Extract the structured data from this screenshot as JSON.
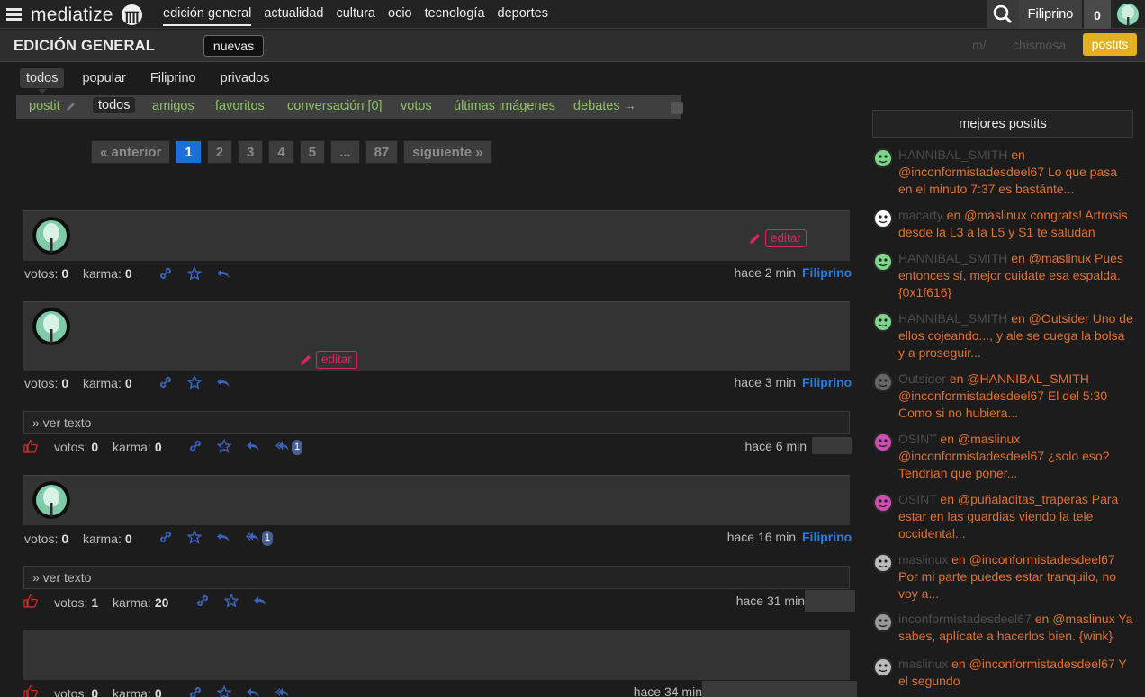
{
  "topbar": {
    "brand": "mediatize",
    "nav": [
      "edición general",
      "actualidad",
      "cultura",
      "ocio",
      "tecnología",
      "deportes"
    ],
    "user": "Filiprino",
    "notifications": "0"
  },
  "subbar": {
    "title": "EDICIÓN GENERAL",
    "nuevas": "nuevas",
    "m": "m/",
    "chismosa": "chismosa",
    "postits": "postits"
  },
  "tabs1": [
    "todos",
    "popular",
    "Filiprino",
    "privados"
  ],
  "tabs2": {
    "postit": "postit",
    "items": [
      "todos",
      "amigos",
      "favoritos",
      "conversación [0]",
      "votos",
      "últimas imágenes",
      "debates →"
    ]
  },
  "pager": [
    "« anterior",
    "1",
    "2",
    "3",
    "4",
    "5",
    "...",
    "87",
    "siguiente »"
  ],
  "labels": {
    "votos": "votos:",
    "karma": "karma:",
    "edit": "editar",
    "ver_texto": "» ver texto"
  },
  "posts": [
    {
      "votos": "0",
      "karma": "0",
      "time": "hace 2 min",
      "author": "Filiprino"
    },
    {
      "votos": "0",
      "karma": "0",
      "time": "hace 3 min",
      "author": "Filiprino"
    },
    {
      "votos": "0",
      "karma": "0",
      "time": "hace 6 min",
      "replies": "1"
    },
    {
      "votos": "0",
      "karma": "0",
      "time": "hace 16 min",
      "author": "Filiprino",
      "replies": "1"
    },
    {
      "votos": "1",
      "karma": "20",
      "time": "hace 31 min"
    },
    {
      "votos": "0",
      "karma": "0",
      "time": "hace 34 min"
    }
  ],
  "sidebar": {
    "title": "mejores postits",
    "en": "en",
    "items": [
      {
        "user": "HANNIBAL_SMITH",
        "text": "@inconformistadesdeel67 Lo que pasa en el minuto 7:37 es bastánte..."
      },
      {
        "user": "macarty",
        "text": "@maslinux congrats! Artrosis desde la L3 a la L5 y S1 te saludan"
      },
      {
        "user": "HANNIBAL_SMITH",
        "text": "@maslinux Pues entonces sí, mejor cuidate esa espalda. {0x1f616}"
      },
      {
        "user": "HANNIBAL_SMITH",
        "text": "@Outsider Uno de ellos cojeando..., y ale se cuega la bolsa y a proseguir..."
      },
      {
        "user": "Outsider",
        "text": "@HANNIBAL_SMITH @inconformistadesdeel67 El del 5:30 Como si no hubiera..."
      },
      {
        "user": "OSINT",
        "text": "@maslinux @inconformistadesdeel67 ¿solo eso? Tendrían que poner..."
      },
      {
        "user": "OSINT",
        "text": "@puñaladitas_traperas Para estar en las guardias viendo la tele occidental..."
      },
      {
        "user": "maslinux",
        "text": "@inconformistadesdeel67 Por mi parte puedes estar tranquilo, no voy a..."
      },
      {
        "user": "inconformistadesdeel67",
        "text": "@maslinux Ya sabes, aplícate a hacerlos bien. {wink}"
      },
      {
        "user": "maslinux",
        "text": "@inconformistadesdeel67 Y el segundo"
      }
    ]
  }
}
